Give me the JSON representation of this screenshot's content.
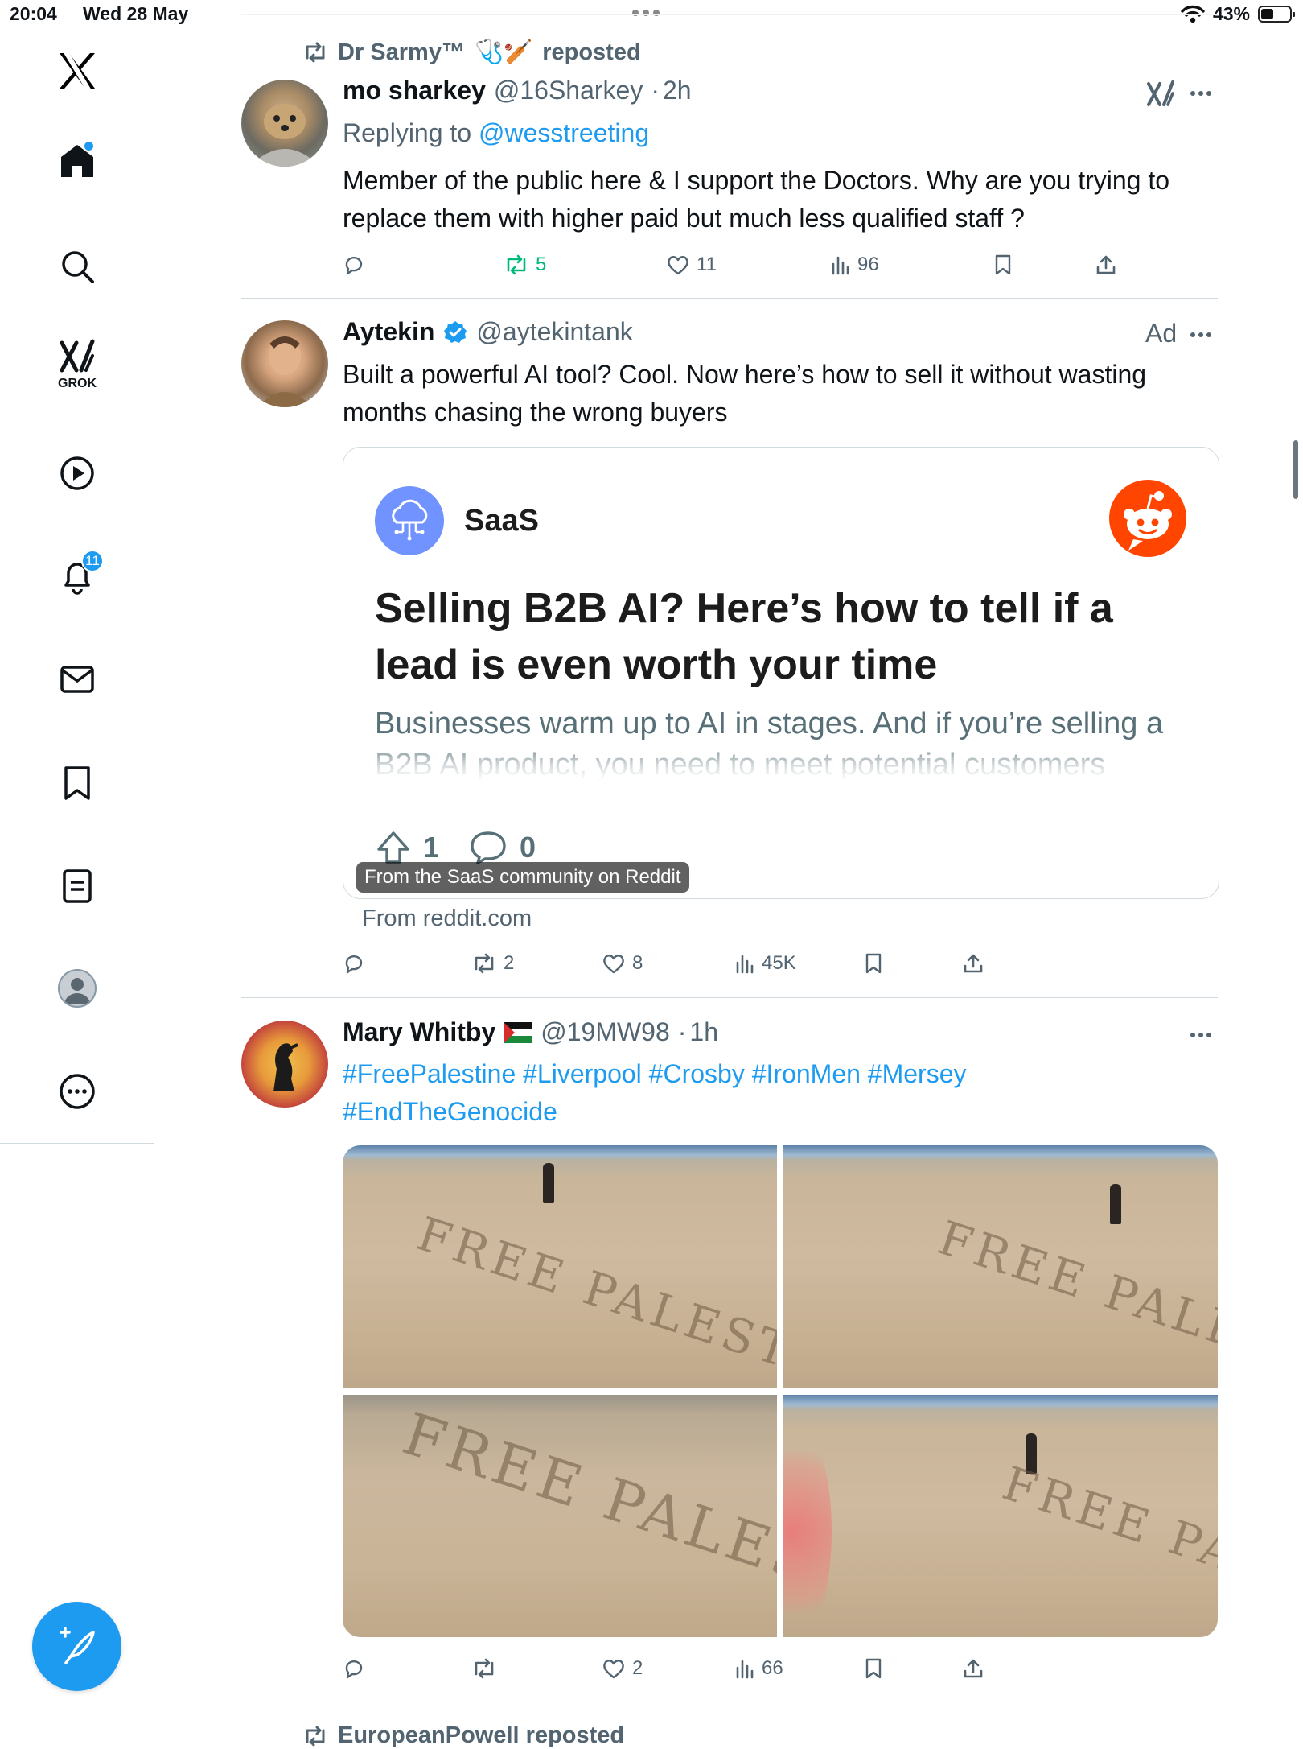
{
  "status_bar": {
    "time": "20:04",
    "date": "Wed 28 May",
    "battery": "43%",
    "battery_level": 0.43
  },
  "sidebar": {
    "grok_label": "GROK",
    "notification_count": "11",
    "items": [
      "x-logo",
      "home",
      "search",
      "grok",
      "video",
      "notifications",
      "messages",
      "bookmarks",
      "lists",
      "profile",
      "more"
    ]
  },
  "posts": [
    {
      "repost_by": "Dr Sarmy™",
      "repost_emoji": "🩺🏏",
      "repost_suffix": "reposted",
      "name": "mo sharkey",
      "handle": "@16Sharkey",
      "time": "2h",
      "replying_prefix": "Replying to",
      "replying_to": "@wesstreeting",
      "text": "Member of the public here & I support the Doctors. Why are you trying to replace them with higher paid but much less qualified staff ?",
      "reposts": "5",
      "likes": "11",
      "views": "96"
    },
    {
      "name": "Aytekin",
      "handle": "@aytekintank",
      "ad_label": "Ad",
      "text": "Built a powerful AI tool? Cool. Now here’s how to sell it without wasting months chasing the wrong buyers",
      "card": {
        "community": "SaaS",
        "title": "Selling B2B AI? Here’s how to tell if a lead is even worth your time",
        "body": "Businesses warm up to AI in stages. And if you’re selling a B2B AI product, you need to meet potential customers where they’re at.",
        "upvotes": "1",
        "comments": "0",
        "overlay": "From the SaaS community on Reddit"
      },
      "from_site": "From reddit.com",
      "reposts": "2",
      "likes": "8",
      "views": "45K"
    },
    {
      "name": "Mary Whitby",
      "flag": "🇵🇸",
      "handle": "@19MW98",
      "time": "1h",
      "hashtags_line1": "#FreePalestine #Liverpool #Crosby #IronMen #Mersey",
      "hashtags_line2": "#EndTheGenocide",
      "sand_text": "FREE PALESTINE",
      "likes": "2",
      "views": "66"
    }
  ],
  "next_repost": "EuropeanPowell reposted",
  "colors": {
    "accent": "#1d9bf0",
    "repost_green": "#00ba7c",
    "muted": "#536471",
    "reddit": "#ff4500",
    "saas": "#7193ff"
  }
}
